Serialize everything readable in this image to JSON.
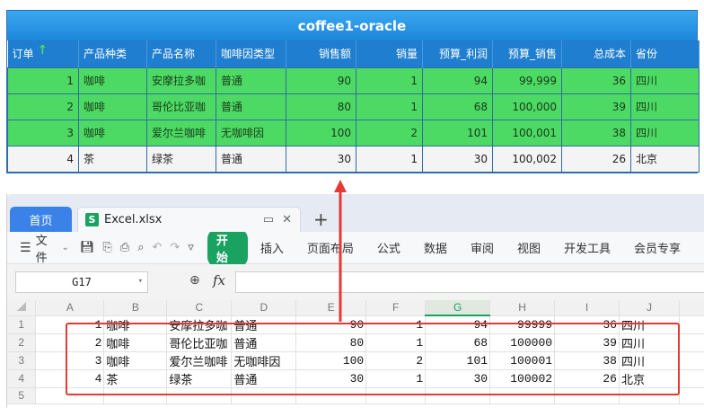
{
  "report": {
    "title": "coffee1-oracle",
    "columns": [
      "订单",
      "产品种类",
      "产品名称",
      "咖啡因类型",
      "销售额",
      "销量",
      "预算_利润",
      "预算_销售",
      "总成本",
      "省份"
    ],
    "sort_indicator": "↑",
    "rows": [
      [
        "1",
        "咖啡",
        "安摩拉多咖",
        "普通",
        "90",
        "1",
        "94",
        "99,999",
        "36",
        "四川"
      ],
      [
        "2",
        "咖啡",
        "哥伦比亚咖",
        "普通",
        "80",
        "1",
        "68",
        "100,000",
        "39",
        "四川"
      ],
      [
        "3",
        "咖啡",
        "爱尔兰咖啡",
        "无咖啡因",
        "100",
        "2",
        "101",
        "100,001",
        "38",
        "四川"
      ],
      [
        "4",
        "茶",
        "绿茶",
        "普通",
        "30",
        "1",
        "30",
        "100,002",
        "26",
        "北京"
      ]
    ],
    "colors": {
      "header": "#1f7ecf",
      "highlight_row": "#4cd964"
    }
  },
  "spreadsheet": {
    "tabs": {
      "home": "首页",
      "file": "Excel.xlsx",
      "add": "+"
    },
    "ribbon": {
      "file_menu": "文件",
      "start": "开始",
      "items": [
        "插入",
        "页面布局",
        "公式",
        "数据",
        "审阅",
        "视图",
        "开发工具",
        "会员专享"
      ]
    },
    "name_box": "G17",
    "fx_label": "fx",
    "column_headers": [
      "A",
      "B",
      "C",
      "D",
      "E",
      "F",
      "G",
      "H",
      "I",
      "J"
    ],
    "selected_column": "G",
    "rows": [
      {
        "row": "1",
        "cells": [
          "1",
          "咖啡",
          "安摩拉多咖",
          "普通",
          "90",
          "1",
          "94",
          "99999",
          "36",
          "四川"
        ]
      },
      {
        "row": "2",
        "cells": [
          "2",
          "咖啡",
          "哥伦比亚咖",
          "普通",
          "80",
          "1",
          "68",
          "100000",
          "39",
          "四川"
        ]
      },
      {
        "row": "3",
        "cells": [
          "3",
          "咖啡",
          "爱尔兰咖啡",
          "无咖啡因",
          "100",
          "2",
          "101",
          "100001",
          "38",
          "四川"
        ]
      },
      {
        "row": "4",
        "cells": [
          "4",
          "茶",
          "绿茶",
          "普通",
          "30",
          "1",
          "30",
          "100002",
          "26",
          "北京"
        ]
      },
      {
        "row": "5",
        "cells": [
          "",
          "",
          "",
          "",
          "",
          "",
          "",
          "",
          "",
          ""
        ]
      }
    ],
    "colors": {
      "accent": "#1aa260",
      "home_tab": "#3b82e8",
      "annotation": "#e53935"
    }
  }
}
